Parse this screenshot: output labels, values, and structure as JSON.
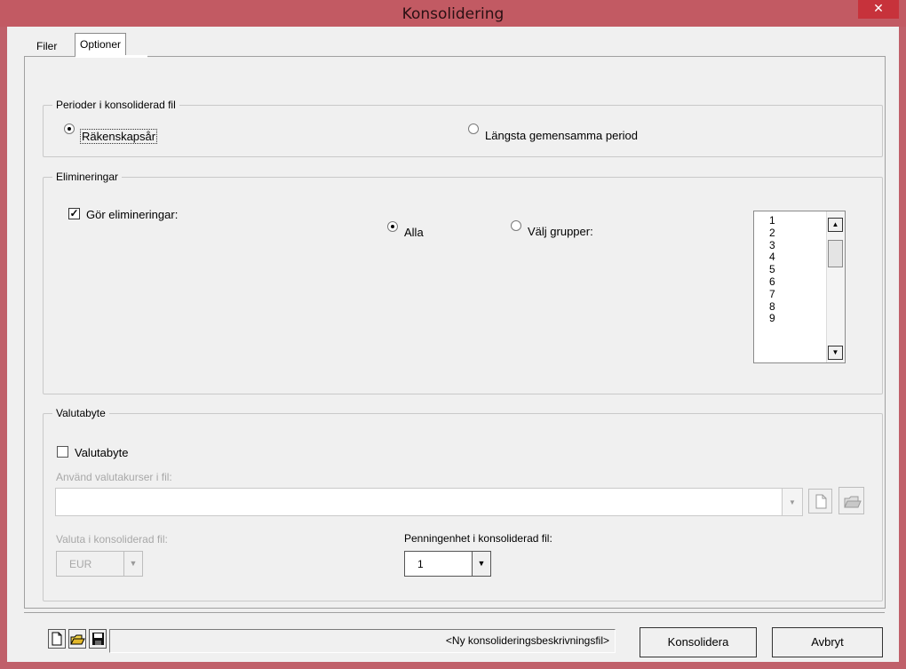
{
  "window": {
    "title": "Konsolidering",
    "close_label": "✕"
  },
  "tabs": [
    {
      "label": "Filer"
    },
    {
      "label": "Optioner"
    }
  ],
  "perioder": {
    "legend": "Perioder i konsoliderad fil",
    "option1": "Räkenskapsår",
    "option2": "Längsta gemensamma period",
    "selected": "Räkenskapsår"
  },
  "elimineringar": {
    "legend": "Elimineringar",
    "checkbox_label": "Gör elimineringar:",
    "checked": true,
    "radio_all": "Alla",
    "radio_select": "Välj grupper:",
    "selected": "Alla",
    "groups": [
      "1",
      "2",
      "3",
      "4",
      "5",
      "6",
      "7",
      "8",
      "9"
    ]
  },
  "valutabyte": {
    "legend": "Valutabyte",
    "checkbox_label": "Valutabyte",
    "checked": false,
    "file_label": "Använd valutakurser i fil:",
    "file_value": "",
    "currency_label": "Valuta i konsoliderad fil:",
    "currency_value": "EUR",
    "unit_label": "Penningenhet i konsoliderad fil:",
    "unit_value": "1"
  },
  "footer": {
    "status": "<Ny konsolideringsbeskrivningsfil>",
    "consolidate_label": "Konsolidera",
    "cancel_label": "Avbryt"
  },
  "icons": [
    "new-file-icon",
    "open-folder-icon",
    "save-icon",
    "close-icon",
    "dropdown-arrow-icon"
  ],
  "colors": {
    "titlebar": "#c25a63",
    "close_button": "#c7323b",
    "dialog": "#f0f0f0"
  }
}
